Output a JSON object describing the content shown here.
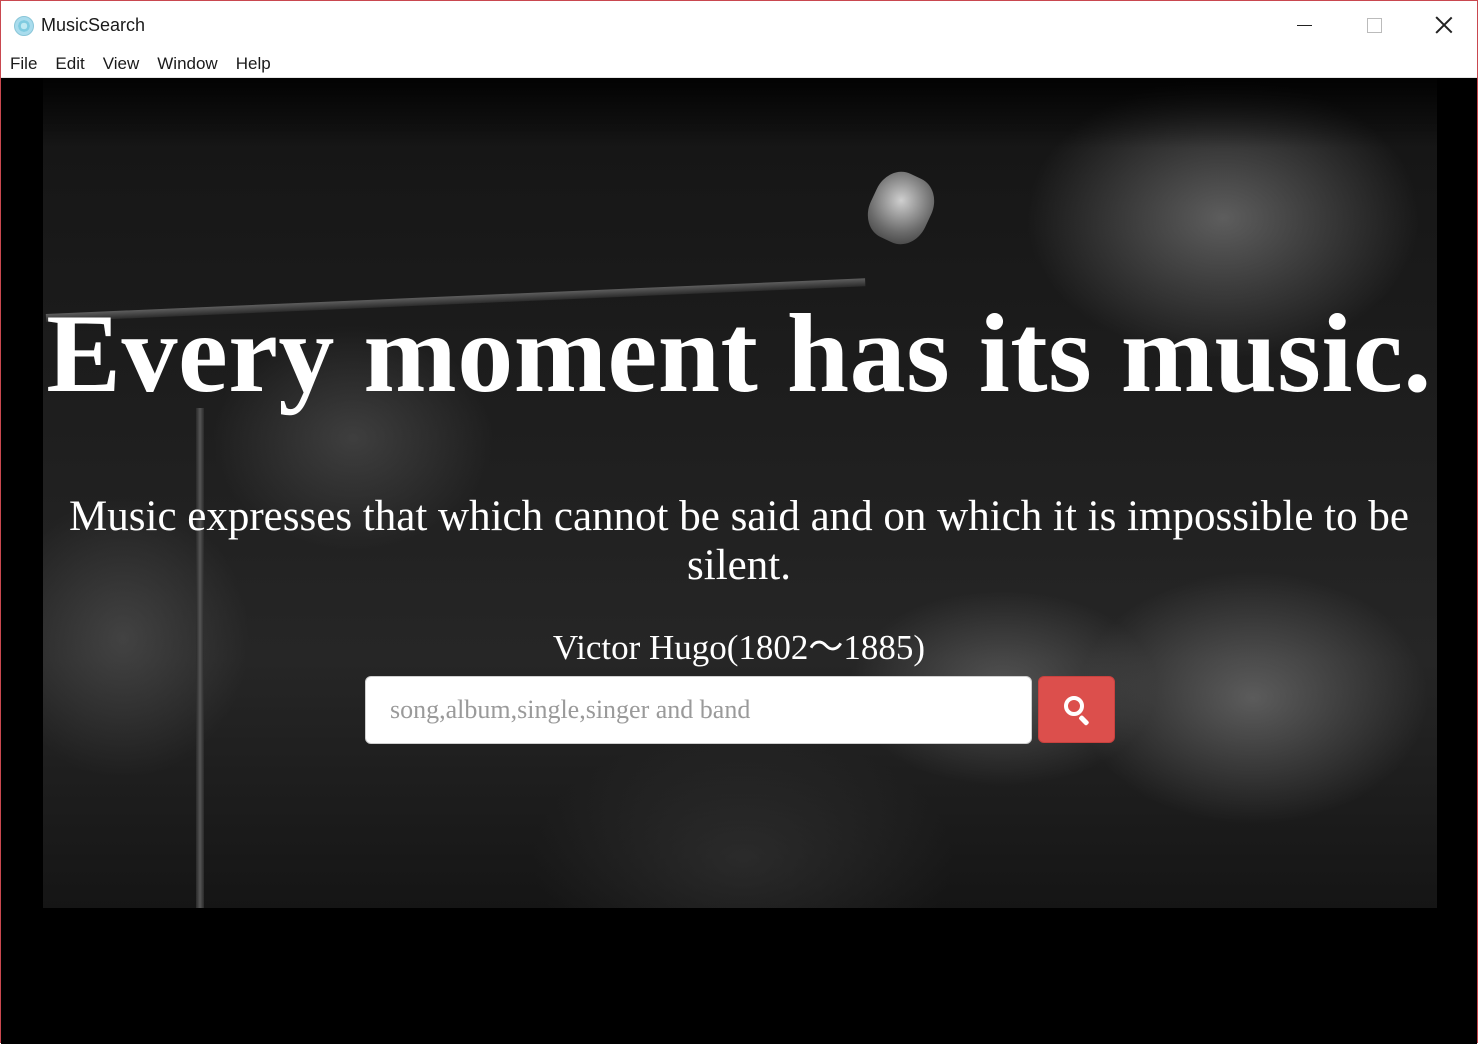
{
  "window": {
    "title": "MusicSearch",
    "app_icon": "electron-icon",
    "controls": [
      "minimize-icon",
      "maximize-icon",
      "close-icon"
    ]
  },
  "menubar": {
    "items": [
      {
        "label": "File"
      },
      {
        "label": "Edit"
      },
      {
        "label": "View"
      },
      {
        "label": "Window"
      },
      {
        "label": "Help"
      }
    ]
  },
  "hero": {
    "headline": "Every moment has its music.",
    "quote": "Music expresses that which cannot be said and on which it is impossible to be silent.",
    "author": "Victor Hugo(1802〜1885)"
  },
  "search": {
    "value": "",
    "placeholder": "song,album,single,singer and band",
    "button_icon": "search-icon",
    "button_color": "#dc4f4c"
  }
}
